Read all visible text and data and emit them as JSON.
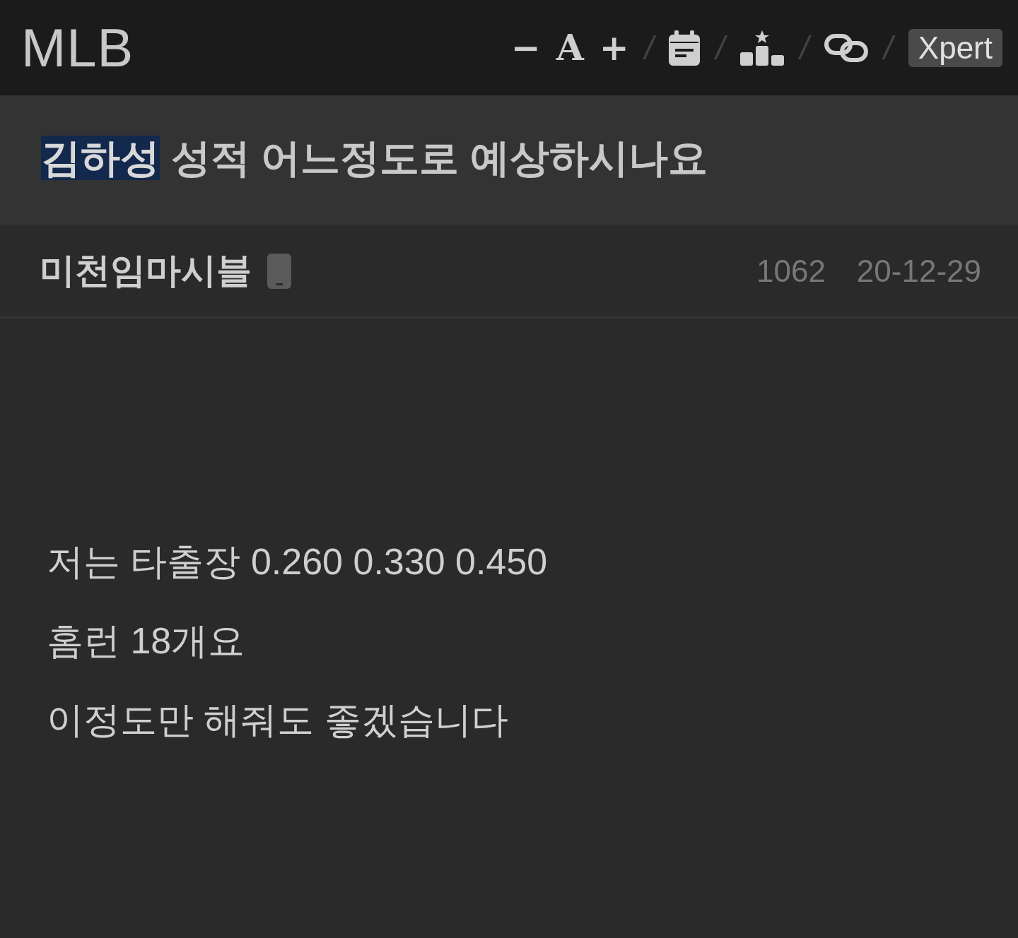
{
  "header": {
    "logo": "MLB",
    "font_controls": [
      "−",
      "A",
      "+"
    ],
    "separator": "/",
    "xpert_button": "Xpert"
  },
  "title": [
    {
      "text": "김하성",
      "selected": true
    },
    {
      "text": " 성적 어느정도로 예상하시나요",
      "selected": false
    }
  ],
  "meta": {
    "author": "미천임마시블",
    "views": "1062",
    "date": "20-12-29"
  },
  "body": [
    "저는 타출장 0.260 0.330 0.450",
    "홈런 18개요",
    "이정도만 해줘도 좋겠습니다"
  ]
}
